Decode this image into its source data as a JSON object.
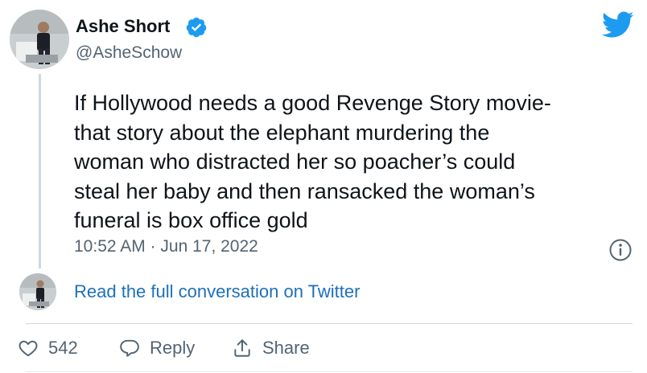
{
  "author": {
    "name": "Ashe Short",
    "handle": "@AsheSchow"
  },
  "tweet": {
    "lines": [
      "If Hollywood needs a good Revenge Story movie-",
      "that story about the elephant murdering the",
      "woman who distracted her so poacher’s could",
      "steal her baby and then ransacked the woman’s",
      "funeral is box office gold"
    ],
    "timestamp": "10:52 AM · Jun 17, 2022"
  },
  "conversation_link": "Read the full conversation on Twitter",
  "actions": {
    "likes": "542",
    "reply_label": "Reply",
    "share_label": "Share"
  },
  "icons": {
    "verified": "verified-badge-icon",
    "twitter": "twitter-bird-icon",
    "info": "info-icon",
    "like": "heart-icon",
    "reply": "speech-bubble-icon",
    "share": "share-icon"
  },
  "colors": {
    "brand_blue": "#1d9bf0",
    "link_blue": "#1d70b8",
    "muted": "#536471",
    "text": "#0f1419"
  }
}
